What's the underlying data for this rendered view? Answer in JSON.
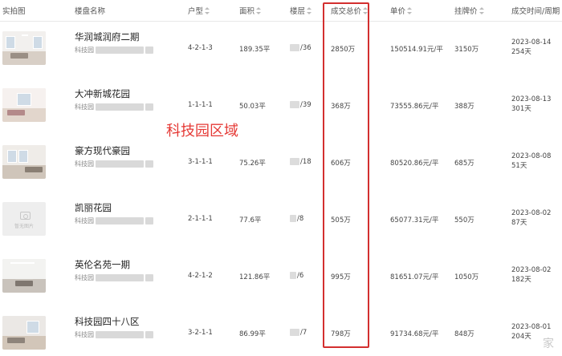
{
  "header": {
    "photo": "实拍图",
    "name": "楼盘名称",
    "layout": "户型",
    "size": "面积",
    "floor": "楼层",
    "total": "成交总价",
    "unit": "单价",
    "list": "挂牌价",
    "date": "成交时间/周期"
  },
  "rows": [
    {
      "name": "华润城润府二期",
      "area": "科技园",
      "layout": "4-2-1-3",
      "size": "189.35平",
      "floor": "/36",
      "total": "2850万",
      "unit": "150514.91元/平",
      "list": "3150万",
      "date": "2023-08-14",
      "cycle": "254天"
    },
    {
      "name": "大冲新城花园",
      "area": "科技园",
      "layout": "1-1-1-1",
      "size": "50.03平",
      "floor": "/39",
      "total": "368万",
      "unit": "73555.86元/平",
      "list": "388万",
      "date": "2023-08-13",
      "cycle": "301天"
    },
    {
      "name": "豪方现代豪园",
      "area": "科技园",
      "layout": "3-1-1-1",
      "size": "75.26平",
      "floor": "/18",
      "total": "606万",
      "unit": "80520.86元/平",
      "list": "685万",
      "date": "2023-08-08",
      "cycle": "51天"
    },
    {
      "name": "凯丽花园",
      "area": "科技园",
      "layout": "2-1-1-1",
      "size": "77.6平",
      "floor": "/8",
      "total": "505万",
      "unit": "65077.31元/平",
      "list": "550万",
      "date": "2023-08-02",
      "cycle": "87天",
      "placeholder": "暂无图片"
    },
    {
      "name": "英伦名苑一期",
      "area": "科技园",
      "layout": "4-2-1-2",
      "size": "121.86平",
      "floor": "/6",
      "total": "995万",
      "unit": "81651.07元/平",
      "list": "1050万",
      "date": "2023-08-02",
      "cycle": "182天"
    },
    {
      "name": "科技园四十八区",
      "area": "科技园",
      "layout": "3-2-1-1",
      "size": "86.99平",
      "floor": "/7",
      "total": "798万",
      "unit": "91734.68元/平",
      "list": "848万",
      "date": "2023-08-01",
      "cycle": "204天"
    }
  ],
  "annotation": "科技园区域",
  "watermark": "家",
  "colors": {
    "highlight": "#d32f2f",
    "annotation": "#e53935"
  }
}
